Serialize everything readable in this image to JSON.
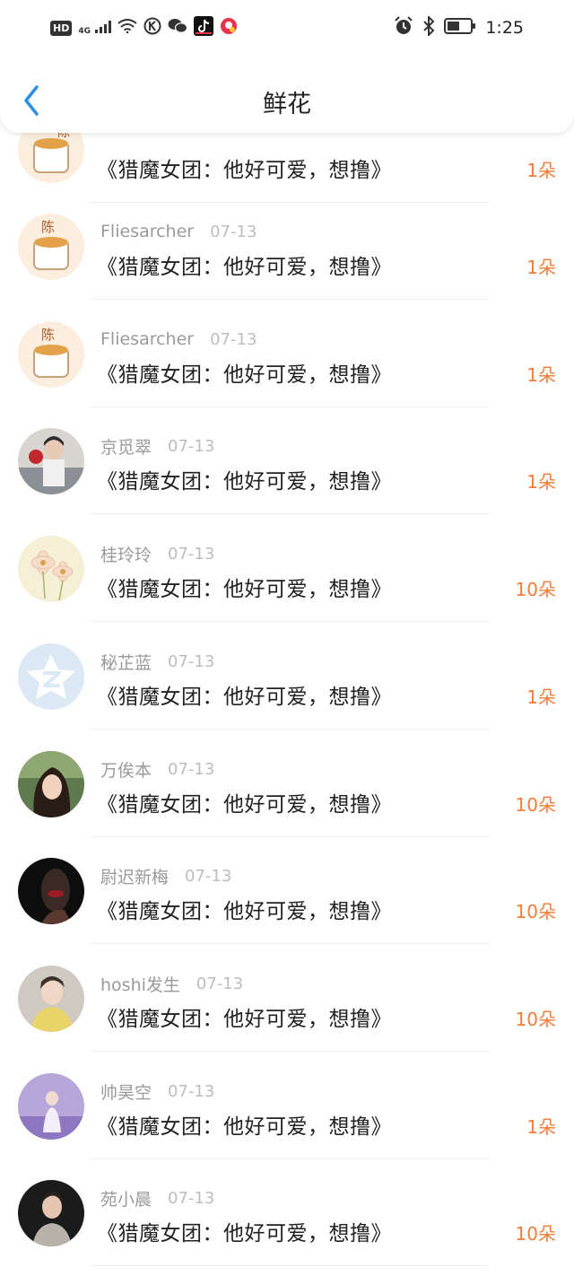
{
  "status_bar": {
    "time": "1:25",
    "hd": "HD",
    "network": "4G"
  },
  "header": {
    "title": "鲜花"
  },
  "colors": {
    "accent": "#ef7d3b",
    "back_arrow": "#2a8fe6"
  },
  "rows": [
    {
      "name": "",
      "date": "",
      "title": "《猎魔女团：他好可爱，想撸》",
      "count": "1朵",
      "avatar": "cake-avatar"
    },
    {
      "name": "Fliesarcher",
      "date": "07-13",
      "title": "《猎魔女团：他好可爱，想撸》",
      "count": "1朵",
      "avatar": "cake-avatar"
    },
    {
      "name": "Fliesarcher",
      "date": "07-13",
      "title": "《猎魔女团：他好可爱，想撸》",
      "count": "1朵",
      "avatar": "cake-avatar"
    },
    {
      "name": "京觅翠",
      "date": "07-13",
      "title": "《猎魔女团：他好可爱，想撸》",
      "count": "1朵",
      "avatar": "photo-avatar"
    },
    {
      "name": "桂玲玲",
      "date": "07-13",
      "title": "《猎魔女团：他好可爱，想撸》",
      "count": "10朵",
      "avatar": "flower-avatar"
    },
    {
      "name": "秘芷蓝",
      "date": "07-13",
      "title": "《猎魔女团：他好可爱，想撸》",
      "count": "1朵",
      "avatar": "default-avatar"
    },
    {
      "name": "万俟本",
      "date": "07-13",
      "title": "《猎魔女团：他好可爱，想撸》",
      "count": "10朵",
      "avatar": "photo-avatar"
    },
    {
      "name": "尉迟新梅",
      "date": "07-13",
      "title": "《猎魔女团：他好可爱，想撸》",
      "count": "10朵",
      "avatar": "photo-avatar"
    },
    {
      "name": "hoshi发生",
      "date": "07-13",
      "title": "《猎魔女团：他好可爱，想撸》",
      "count": "10朵",
      "avatar": "photo-avatar"
    },
    {
      "name": "帅昊空",
      "date": "07-13",
      "title": "《猎魔女团：他好可爱，想撸》",
      "count": "1朵",
      "avatar": "photo-avatar"
    },
    {
      "name": "苑小晨",
      "date": "07-13",
      "title": "《猎魔女团：他好可爱，想撸》",
      "count": "10朵",
      "avatar": "photo-avatar"
    }
  ]
}
